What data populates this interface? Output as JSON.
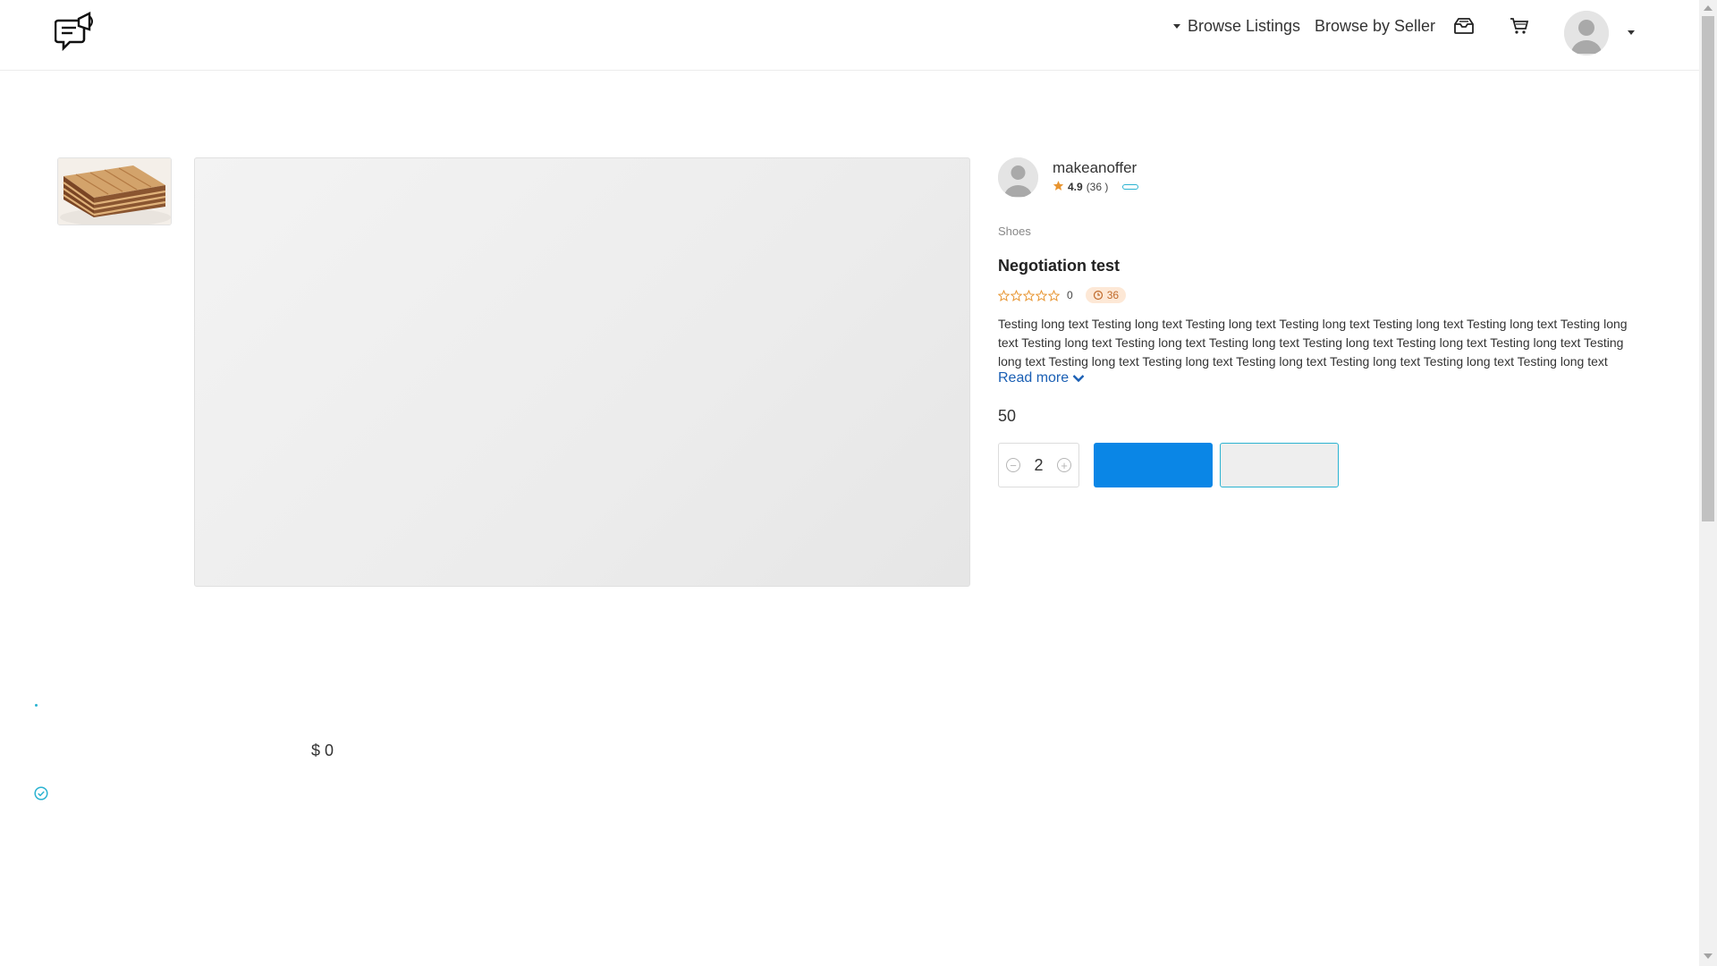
{
  "header": {
    "nav_browse_label": "Browse Listings",
    "nav_seller_label": "Browse by Seller",
    "icons": [
      "logo-chat-megaphone-icon",
      "inbox-tray-icon",
      "cart-icon",
      "user-avatar-icon",
      "caret-down-icon"
    ]
  },
  "seller": {
    "name": "makeanoffer",
    "rating": "4.9",
    "reviews": "(36 )"
  },
  "listing": {
    "category": "Shoes",
    "title": "Negotiation test",
    "rating_count": "0",
    "time_badge": "36",
    "description": "Testing long text Testing long text Testing long text Testing long text Testing long text Testing long text Testing long text Testing long text Testing long text Testing long text Testing long text Testing long text Testing long text Testing long text Testing long text Testing long text Testing long text Testing long text Testing long text Testing long text Testing long text Testing long text",
    "read_more_label": "Read more",
    "price": "50",
    "quantity": "2",
    "primary_button_label": "",
    "secondary_button_label": ""
  },
  "summary": {
    "total": "$ 0"
  },
  "colors": {
    "accent_blue": "#0a86e6",
    "accent_teal": "#2bb3d1",
    "star_orange": "#e8942f",
    "link_blue": "#1a5fb4"
  }
}
